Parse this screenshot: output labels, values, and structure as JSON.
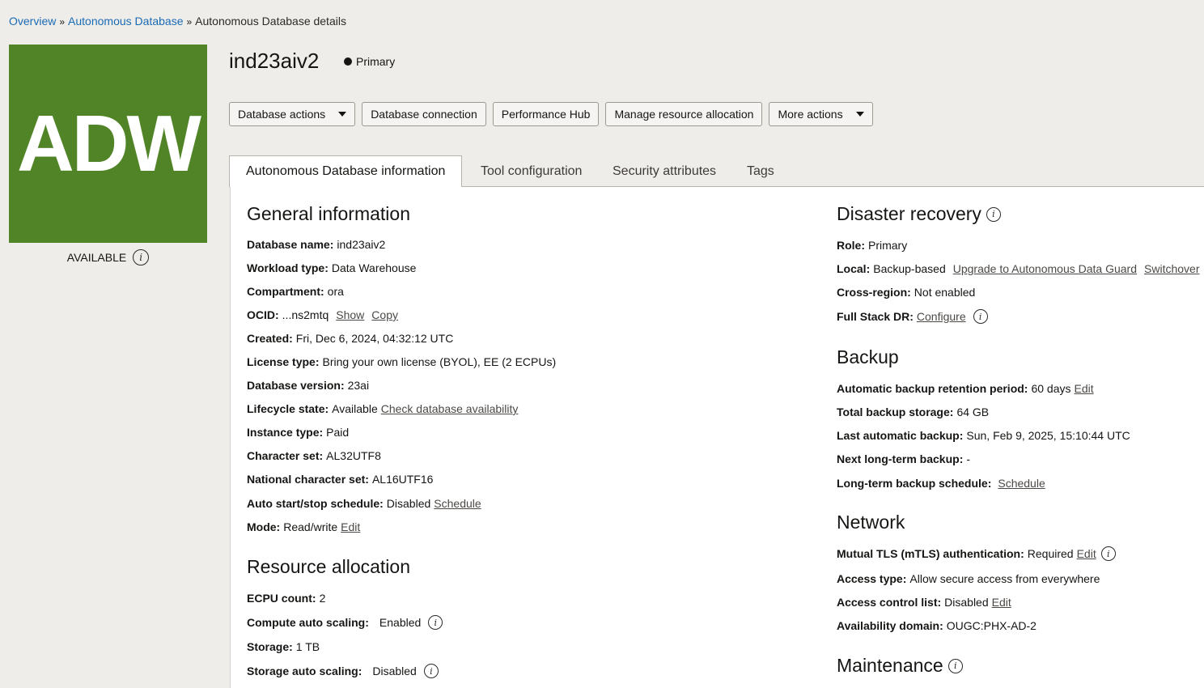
{
  "breadcrumb": {
    "items": [
      "Overview",
      "Autonomous Database",
      "Autonomous Database details"
    ],
    "separator": "»"
  },
  "logo": {
    "text": "ADW",
    "color": "#508427"
  },
  "status": {
    "label": "AVAILABLE",
    "icon": "info-icon"
  },
  "header": {
    "title": "ind23aiv2",
    "role_badge": "Primary"
  },
  "actions": [
    {
      "label": "Database actions",
      "dropdown": true
    },
    {
      "label": "Database connection",
      "dropdown": false
    },
    {
      "label": "Performance Hub",
      "dropdown": false
    },
    {
      "label": "Manage resource allocation",
      "dropdown": false
    },
    {
      "label": "More actions",
      "dropdown": true
    }
  ],
  "tabs": [
    "Autonomous Database information",
    "Tool configuration",
    "Security attributes",
    "Tags"
  ],
  "general": {
    "heading": "General information",
    "db_name_label": "Database name:",
    "db_name": "ind23aiv2",
    "workload_label": "Workload type:",
    "workload": "Data Warehouse",
    "compartment_label": "Compartment:",
    "compartment": "ora",
    "ocid_label": "OCID:",
    "ocid": "...ns2mtq",
    "ocid_show": "Show",
    "ocid_copy": "Copy",
    "created_label": "Created:",
    "created": "Fri, Dec 6, 2024, 04:32:12 UTC",
    "license_label": "License type:",
    "license": "Bring your own license (BYOL), EE (2 ECPUs)",
    "version_label": "Database version:",
    "version": "23ai",
    "lifecycle_label": "Lifecycle state:",
    "lifecycle": "Available",
    "lifecycle_link": "Check database availability",
    "instance_label": "Instance type:",
    "instance": "Paid",
    "charset_label": "Character set:",
    "charset": "AL32UTF8",
    "ncharset_label": "National character set:",
    "ncharset": "AL16UTF16",
    "autostart_label": "Auto start/stop schedule:",
    "autostart": "Disabled",
    "autostart_link": "Schedule",
    "mode_label": "Mode:",
    "mode": "Read/write",
    "mode_link": "Edit"
  },
  "resource": {
    "heading": "Resource allocation",
    "ecpu_label": "ECPU count:",
    "ecpu": "2",
    "compute_scaling_label": "Compute auto scaling:",
    "compute_scaling": "Enabled",
    "storage_label": "Storage:",
    "storage": "1 TB",
    "storage_scaling_label": "Storage auto scaling:",
    "storage_scaling": "Disabled"
  },
  "dr": {
    "heading": "Disaster recovery",
    "role_label": "Role:",
    "role": "Primary",
    "local_label": "Local:",
    "local": "Backup-based",
    "local_link1": "Upgrade to Autonomous Data Guard",
    "local_link2": "Switchover",
    "cross_label": "Cross-region:",
    "cross": "Not enabled",
    "fsdr_label": "Full Stack DR:",
    "fsdr_link": "Configure"
  },
  "backup": {
    "heading": "Backup",
    "retention_label": "Automatic backup retention period:",
    "retention": "60 days",
    "retention_link": "Edit",
    "total_label": "Total backup storage:",
    "total": "64 GB",
    "last_label": "Last automatic backup:",
    "last": "Sun, Feb 9, 2025, 15:10:44 UTC",
    "next_label": "Next long-term backup:",
    "next": "-",
    "schedule_label": "Long-term backup schedule:",
    "schedule_link": "Schedule"
  },
  "network": {
    "heading": "Network",
    "mtls_label": "Mutual TLS (mTLS) authentication:",
    "mtls": "Required",
    "mtls_link": "Edit",
    "access_label": "Access type:",
    "access": "Allow secure access from everywhere",
    "acl_label": "Access control list:",
    "acl": "Disabled",
    "acl_link": "Edit",
    "ad_label": "Availability domain:",
    "ad": "OUGC:PHX-AD-2"
  },
  "maintenance": {
    "heading": "Maintenance"
  }
}
